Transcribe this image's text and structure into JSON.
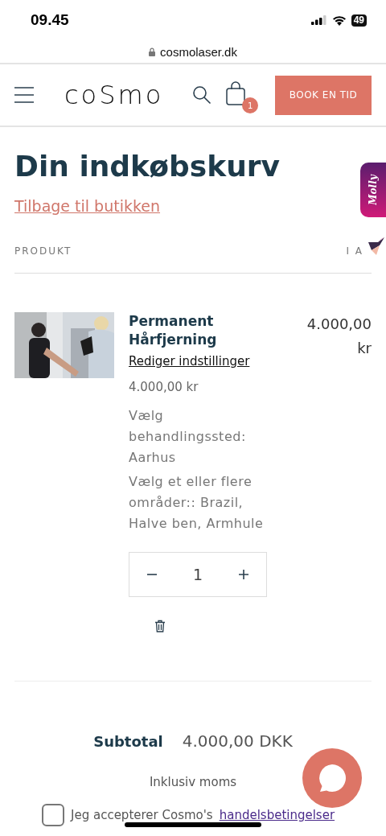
{
  "status_bar": {
    "time": "09.45",
    "battery": "49"
  },
  "browser": {
    "url": "cosmolaser.dk"
  },
  "header": {
    "logo": "coSmo",
    "cart_count": "1",
    "book_button": "BOOK EN TID"
  },
  "side_tab": {
    "label": "Molly"
  },
  "page": {
    "title": "Din indkøbskurv",
    "back_link": "Tilbage til butikken"
  },
  "table": {
    "columns": [
      "PRODUKT",
      "I A"
    ]
  },
  "items": [
    {
      "kind": "picture",
      "name": "Permanent Hårfjerning",
      "edit_link": "Rediger indstillinger",
      "unit_price": "4.000,00 kr",
      "options": [
        "Vælg behandlingssted: Aarhus",
        "Vælg et eller flere områder:: Brazil, Halve ben, Armhule"
      ],
      "quantity": "1",
      "total": "4.000,00 kr"
    }
  ],
  "summary": {
    "subtotal_label": "Subtotal",
    "subtotal_value": "4.000,00 DKK",
    "tax_note": "Inklusiv moms"
  },
  "terms": {
    "checked": false,
    "text": "Jeg accepterer Cosmo's",
    "link": "handelsbetingelser"
  }
}
